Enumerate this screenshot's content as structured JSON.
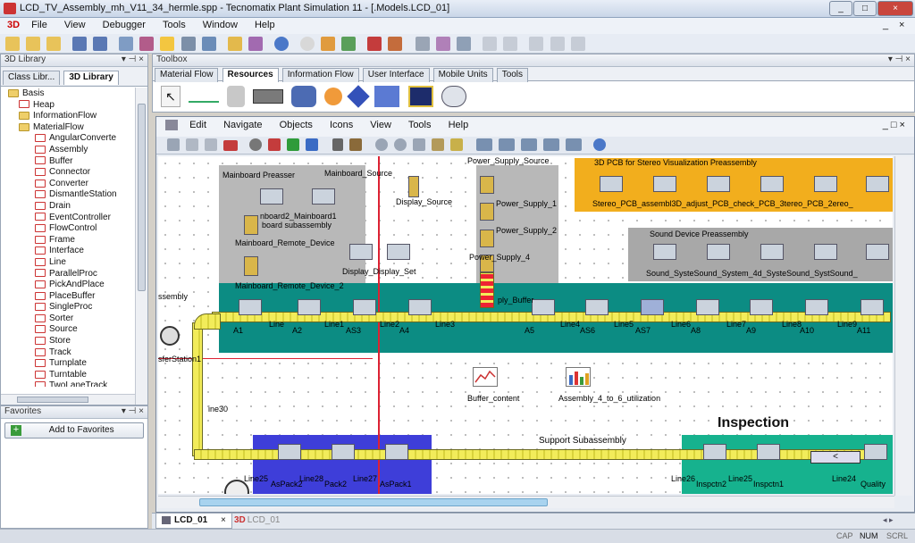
{
  "app": {
    "title": "LCD_TV_Assembly_mh_V11_34_hermle.spp - Tecnomatix Plant Simulation 11 - [.Models.LCD_01]",
    "caption_buttons": [
      "_",
      "□",
      "×"
    ]
  },
  "menu": [
    "File",
    "View",
    "Debugger",
    "Tools",
    "Window",
    "Help"
  ],
  "mdi_controls": [
    "_",
    "×"
  ],
  "library": {
    "title": "3D Library",
    "tabs": [
      "Class Libr...",
      "3D Library"
    ],
    "items": [
      {
        "label": "Basis",
        "icon": "folder"
      },
      {
        "label": "Heap",
        "icon": "3d"
      },
      {
        "label": "InformationFlow",
        "icon": "folder"
      },
      {
        "label": "MaterialFlow",
        "icon": "folder"
      },
      {
        "label": "AngularConverte",
        "icon": "3d"
      },
      {
        "label": "Assembly",
        "icon": "3d"
      },
      {
        "label": "Buffer",
        "icon": "3d"
      },
      {
        "label": "Connector",
        "icon": "3d"
      },
      {
        "label": "Converter",
        "icon": "3d"
      },
      {
        "label": "DismantleStation",
        "icon": "3d"
      },
      {
        "label": "Drain",
        "icon": "3d"
      },
      {
        "label": "EventController",
        "icon": "3d"
      },
      {
        "label": "FlowControl",
        "icon": "3d"
      },
      {
        "label": "Frame",
        "icon": "3d"
      },
      {
        "label": "Interface",
        "icon": "3d"
      },
      {
        "label": "Line",
        "icon": "3d"
      },
      {
        "label": "ParallelProc",
        "icon": "3d"
      },
      {
        "label": "PickAndPlace",
        "icon": "3d"
      },
      {
        "label": "PlaceBuffer",
        "icon": "3d"
      },
      {
        "label": "SingleProc",
        "icon": "3d"
      },
      {
        "label": "Sorter",
        "icon": "3d"
      },
      {
        "label": "Source",
        "icon": "3d"
      },
      {
        "label": "Store",
        "icon": "3d"
      },
      {
        "label": "Track",
        "icon": "3d"
      },
      {
        "label": "Turnplate",
        "icon": "3d"
      },
      {
        "label": "Turntable",
        "icon": "3d"
      },
      {
        "label": "TwoLaneTrack",
        "icon": "3d"
      }
    ]
  },
  "favorites": {
    "title": "Favorites",
    "add_label": "Add to Favorites"
  },
  "toolbox": {
    "title": "Toolbox",
    "tabs": [
      "Material Flow",
      "Resources",
      "Information Flow",
      "User Interface",
      "Mobile Units",
      "Tools"
    ],
    "active": "Resources"
  },
  "frame_window": {
    "menu": [
      "Edit",
      "Navigate",
      "Objects",
      "Icons",
      "View",
      "Tools",
      "Help"
    ]
  },
  "model": {
    "areas": [
      "Mainboard Preasser",
      "3D PCB for Stereo Visualization Preassembly",
      "Sound Device Preassembly",
      "Support Subassembly",
      "Inspection"
    ],
    "labels": [
      "Mainboard_Source",
      "Power_Supply_Source",
      "Display_Source",
      "Power_Supply_1",
      "Power_Supply_2",
      "Power_Supply_4",
      "Mainboard_Remote_Device",
      "Display_Display_Set",
      "Mainboard_Remote_Device_2",
      "Stereo_PCB_assembl3D_adjust_PCB_check_PCB_3tereo_PCB_2ereo_",
      "Sound_SysteSound_System_4d_SysteSound_SystSound_",
      "A1",
      "A2",
      "Line",
      "Line1",
      "AS3",
      "Line2",
      "A4",
      "Line3",
      "A5",
      "Line4",
      "AS6",
      "Line5",
      "AS7",
      "Line6",
      "A8",
      "Line7",
      "A9",
      "Line8",
      "A10",
      "Line9",
      "A11",
      "Buffer_content",
      "Assembly_4_to_6_utilization",
      "Line25",
      "AsPack2",
      "Line28",
      "Pack2",
      "Line27",
      "AsPack1",
      "Line26",
      "Inspctn2",
      "Line25",
      "Inspctn1",
      "Line24",
      "Quality",
      "ine30",
      "sferStation1",
      "ssembly",
      "nboard2_Mainboard1",
      "board subassembly",
      "ply_Buffer"
    ]
  },
  "doc_tabs": [
    {
      "label": "LCD_01",
      "active": true
    },
    {
      "label": "LCD_01",
      "active": false
    }
  ],
  "status": [
    "CAP",
    "NUM",
    "SCRL"
  ]
}
